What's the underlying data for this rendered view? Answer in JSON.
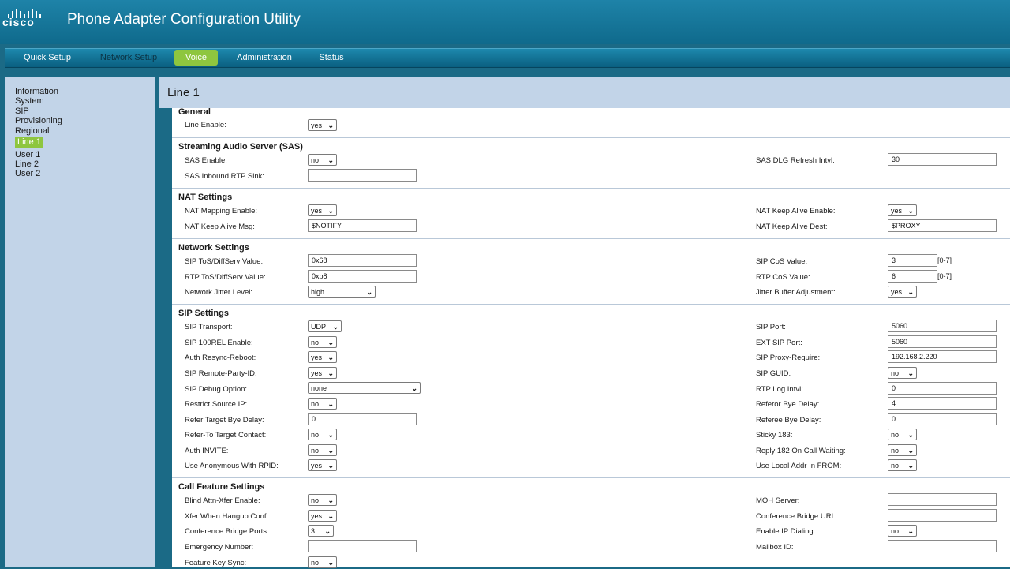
{
  "app": {
    "brand": "cisco",
    "title": "Phone Adapter Configuration Utility"
  },
  "nav": {
    "tabs": [
      {
        "label": "Quick Setup"
      },
      {
        "label": "Network Setup"
      },
      {
        "label": "Voice"
      },
      {
        "label": "Administration"
      },
      {
        "label": "Status"
      }
    ],
    "active": "Voice"
  },
  "sidebar": {
    "items": [
      {
        "label": "Information"
      },
      {
        "label": "System"
      },
      {
        "label": "SIP"
      },
      {
        "label": "Provisioning"
      },
      {
        "label": "Regional"
      },
      {
        "label": "Line 1"
      },
      {
        "label": "User 1"
      },
      {
        "label": "Line 2"
      },
      {
        "label": "User 2"
      }
    ],
    "active": "Line 1"
  },
  "page": {
    "title": "Line 1"
  },
  "sections": {
    "general": {
      "title": "General",
      "line_enable": {
        "label": "Line Enable:",
        "value": "yes"
      }
    },
    "sas": {
      "title": "Streaming Audio Server (SAS)",
      "sas_enable": {
        "label": "SAS Enable:",
        "value": "no"
      },
      "sas_dlg_refresh": {
        "label": "SAS DLG Refresh Intvl:",
        "value": "30"
      },
      "sas_inbound": {
        "label": "SAS Inbound RTP Sink:",
        "value": ""
      }
    },
    "nat": {
      "title": "NAT Settings",
      "nat_mapping": {
        "label": "NAT Mapping Enable:",
        "value": "yes"
      },
      "nat_keepalive_enable": {
        "label": "NAT Keep Alive Enable:",
        "value": "yes"
      },
      "nat_keepalive_msg": {
        "label": "NAT Keep Alive Msg:",
        "value": "$NOTIFY"
      },
      "nat_keepalive_dest": {
        "label": "NAT Keep Alive Dest:",
        "value": "$PROXY"
      }
    },
    "network": {
      "title": "Network Settings",
      "sip_tos": {
        "label": "SIP ToS/DiffServ Value:",
        "value": "0x68"
      },
      "sip_cos": {
        "label": "SIP CoS Value:",
        "value": "3",
        "hint": "[0-7]"
      },
      "rtp_tos": {
        "label": "RTP ToS/DiffServ Value:",
        "value": "0xb8"
      },
      "rtp_cos": {
        "label": "RTP CoS Value:",
        "value": "6",
        "hint": "[0-7]"
      },
      "jitter_level": {
        "label": "Network Jitter Level:",
        "value": "high"
      },
      "jitter_adj": {
        "label": "Jitter Buffer Adjustment:",
        "value": "yes"
      }
    },
    "sip": {
      "title": "SIP Settings",
      "transport": {
        "label": "SIP Transport:",
        "value": "UDP"
      },
      "port": {
        "label": "SIP Port:",
        "value": "5060"
      },
      "rel100": {
        "label": "SIP 100REL Enable:",
        "value": "no"
      },
      "ext_port": {
        "label": "EXT SIP Port:",
        "value": "5060"
      },
      "auth_resync": {
        "label": "Auth Resync-Reboot:",
        "value": "yes"
      },
      "proxy_require": {
        "label": "SIP Proxy-Require:",
        "value": "192.168.2.220"
      },
      "remote_party": {
        "label": "SIP Remote-Party-ID:",
        "value": "yes"
      },
      "guid": {
        "label": "SIP GUID:",
        "value": "no"
      },
      "debug": {
        "label": "SIP Debug Option:",
        "value": "none"
      },
      "rtp_log": {
        "label": "RTP Log Intvl:",
        "value": "0"
      },
      "restrict_ip": {
        "label": "Restrict Source IP:",
        "value": "no"
      },
      "referor_bye": {
        "label": "Referor Bye Delay:",
        "value": "4"
      },
      "refer_target_bye": {
        "label": "Refer Target Bye Delay:",
        "value": "0"
      },
      "referee_bye": {
        "label": "Referee Bye Delay:",
        "value": "0"
      },
      "refer_to_target": {
        "label": "Refer-To Target Contact:",
        "value": "no"
      },
      "sticky183": {
        "label": "Sticky 183:",
        "value": "no"
      },
      "auth_invite": {
        "label": "Auth INVITE:",
        "value": "no"
      },
      "reply182": {
        "label": "Reply 182 On Call Waiting:",
        "value": "no"
      },
      "anon_rpid": {
        "label": "Use Anonymous With RPID:",
        "value": "yes"
      },
      "local_addr": {
        "label": "Use Local Addr In FROM:",
        "value": "no"
      }
    },
    "call": {
      "title": "Call Feature Settings",
      "blind_xfer": {
        "label": "Blind Attn-Xfer Enable:",
        "value": "no"
      },
      "moh": {
        "label": "MOH Server:",
        "value": ""
      },
      "xfer_hangup": {
        "label": "Xfer When Hangup Conf:",
        "value": "yes"
      },
      "conf_url": {
        "label": "Conference Bridge URL:",
        "value": ""
      },
      "conf_ports": {
        "label": "Conference Bridge Ports:",
        "value": "3"
      },
      "ip_dialing": {
        "label": "Enable IP Dialing:",
        "value": "no"
      },
      "emergency": {
        "label": "Emergency Number:",
        "value": ""
      },
      "mailbox": {
        "label": "Mailbox ID:",
        "value": ""
      },
      "feature_sync": {
        "label": "Feature Key Sync:",
        "value": "no"
      }
    }
  }
}
